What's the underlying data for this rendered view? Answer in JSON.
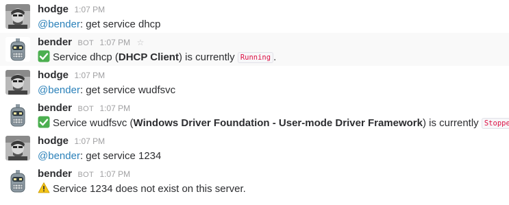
{
  "messages": [
    {
      "author": "hodge",
      "time": "1:07 PM",
      "mention": "@bender",
      "text": ": get service dhcp"
    },
    {
      "author": "bender",
      "badge": "BOT",
      "time": "1:07 PM",
      "status_icon": "check-mark-icon",
      "parts": [
        "Service dhcp (",
        "DHCP Client",
        ") is currently ",
        "Running",
        "."
      ]
    },
    {
      "author": "hodge",
      "time": "1:07 PM",
      "mention": "@bender",
      "text": ": get service wudfsvc"
    },
    {
      "author": "bender",
      "badge": "BOT",
      "time": "1:07 PM",
      "status_icon": "check-mark-icon",
      "parts": [
        "Service wudfsvc (",
        "Windows Driver Foundation - User-mode Driver Framework",
        ") is currently ",
        "Stopped",
        "."
      ]
    },
    {
      "author": "hodge",
      "time": "1:07 PM",
      "mention": "@bender",
      "text": ": get service 1234"
    },
    {
      "author": "bender",
      "badge": "BOT",
      "time": "1:07 PM",
      "status_icon": "warning-icon",
      "text": "Service 1234 does not exist on this server."
    }
  ],
  "colors": {
    "mention": "#2a80b9",
    "code_text": "#dd1144",
    "check_green": "#4caf50",
    "warning_yellow": "#f5c518",
    "hover_bg": "#f9f9f9"
  }
}
